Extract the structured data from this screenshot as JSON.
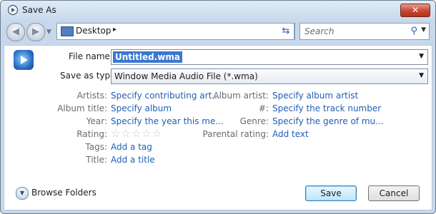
{
  "window": {
    "title": "Save As",
    "close_label": "✕"
  },
  "toolbar": {
    "location": "Desktop",
    "separator": "▸",
    "search_placeholder": "Search"
  },
  "form": {
    "file_name_label": "File name:",
    "file_name_value": "Untitled.wma",
    "save_type_label": "Save as type:",
    "save_type_value": "Window Media Audio File (*.wma)"
  },
  "metadata": {
    "artists_label": "Artists:",
    "artists_value": "Specify contributing art...",
    "album_title_label": "Album title:",
    "album_title_value": "Specify album",
    "year_label": "Year:",
    "year_value": "Specify the year this me...",
    "rating_label": "Rating:",
    "rating_stars": "☆☆☆☆☆",
    "rating_value": 0,
    "tags_label": "Tags:",
    "tags_value": "Add a tag",
    "title_label": "Title:",
    "title_value": "Add a title",
    "album_artist_label": "Album artist:",
    "album_artist_value": "Specify album artist",
    "number_label": "#:",
    "number_value": "Specify the track number",
    "genre_label": "Genre:",
    "genre_value": "Specify the genre of mu...",
    "parental_label": "Parental rating:",
    "parental_value": "Add text"
  },
  "footer": {
    "browse_label": "Browse Folders",
    "save_label": "Save",
    "cancel_label": "Cancel"
  }
}
